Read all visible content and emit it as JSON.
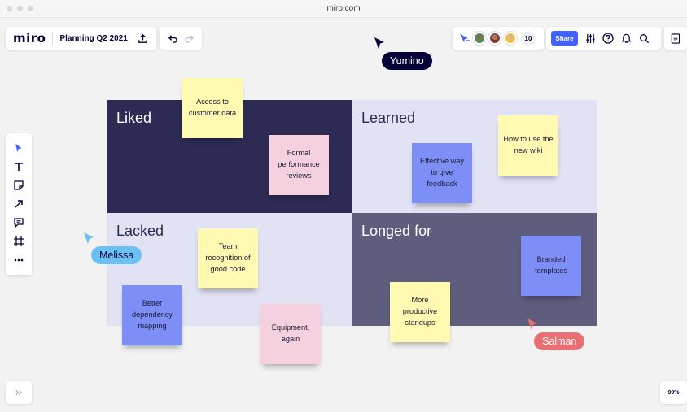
{
  "browser": {
    "url": "miro.com"
  },
  "topbar": {
    "logo": "miro",
    "board_title": "Planning Q2 2021",
    "collaborator_count": "10",
    "share_label": "Share"
  },
  "zoom": {
    "level": "99%"
  },
  "board": {
    "quadrants": {
      "liked": "Liked",
      "learned": "Learned",
      "lacked": "Lacked",
      "longed": "Longed for"
    },
    "stickies": {
      "access": "Access to customer data",
      "formal": "Formal performance reviews",
      "effective": "Effective way to give feedback",
      "howto": "How to use the new wiki",
      "team": "Team recognition of good code",
      "better": "Better dependency mapping",
      "equipment": "Equipment, again",
      "standups": "More productive standups",
      "branded": "Branded templates"
    }
  },
  "cursors": {
    "yumino": "Yumino",
    "melissa": "Melissa",
    "salman": "Salman"
  },
  "colors": {
    "accent": "#4262ff",
    "liked_bg": "#2d2b53",
    "learned_bg": "#e1e2f4",
    "longed_bg": "#5f5d7d",
    "sticky_yellow": "#fff9b1",
    "sticky_pink": "#f5d0df",
    "sticky_blue": "#7d8ef7",
    "cursor_yumino": "#050038",
    "cursor_melissa": "#69c1f4",
    "cursor_salman": "#ea6f73"
  },
  "icons": {
    "upload": "upload-icon",
    "undo": "undo-icon",
    "redo": "redo-icon",
    "settings": "sliders-icon",
    "help": "help-icon",
    "notifications": "bell-icon",
    "search": "search-icon",
    "notes": "notes-icon",
    "select": "cursor-icon",
    "text": "text-icon",
    "sticky": "sticky-note-icon",
    "connector": "arrow-icon",
    "comment": "comment-icon",
    "frame": "frame-icon",
    "more": "more-icon",
    "expand": "expand-icon"
  }
}
